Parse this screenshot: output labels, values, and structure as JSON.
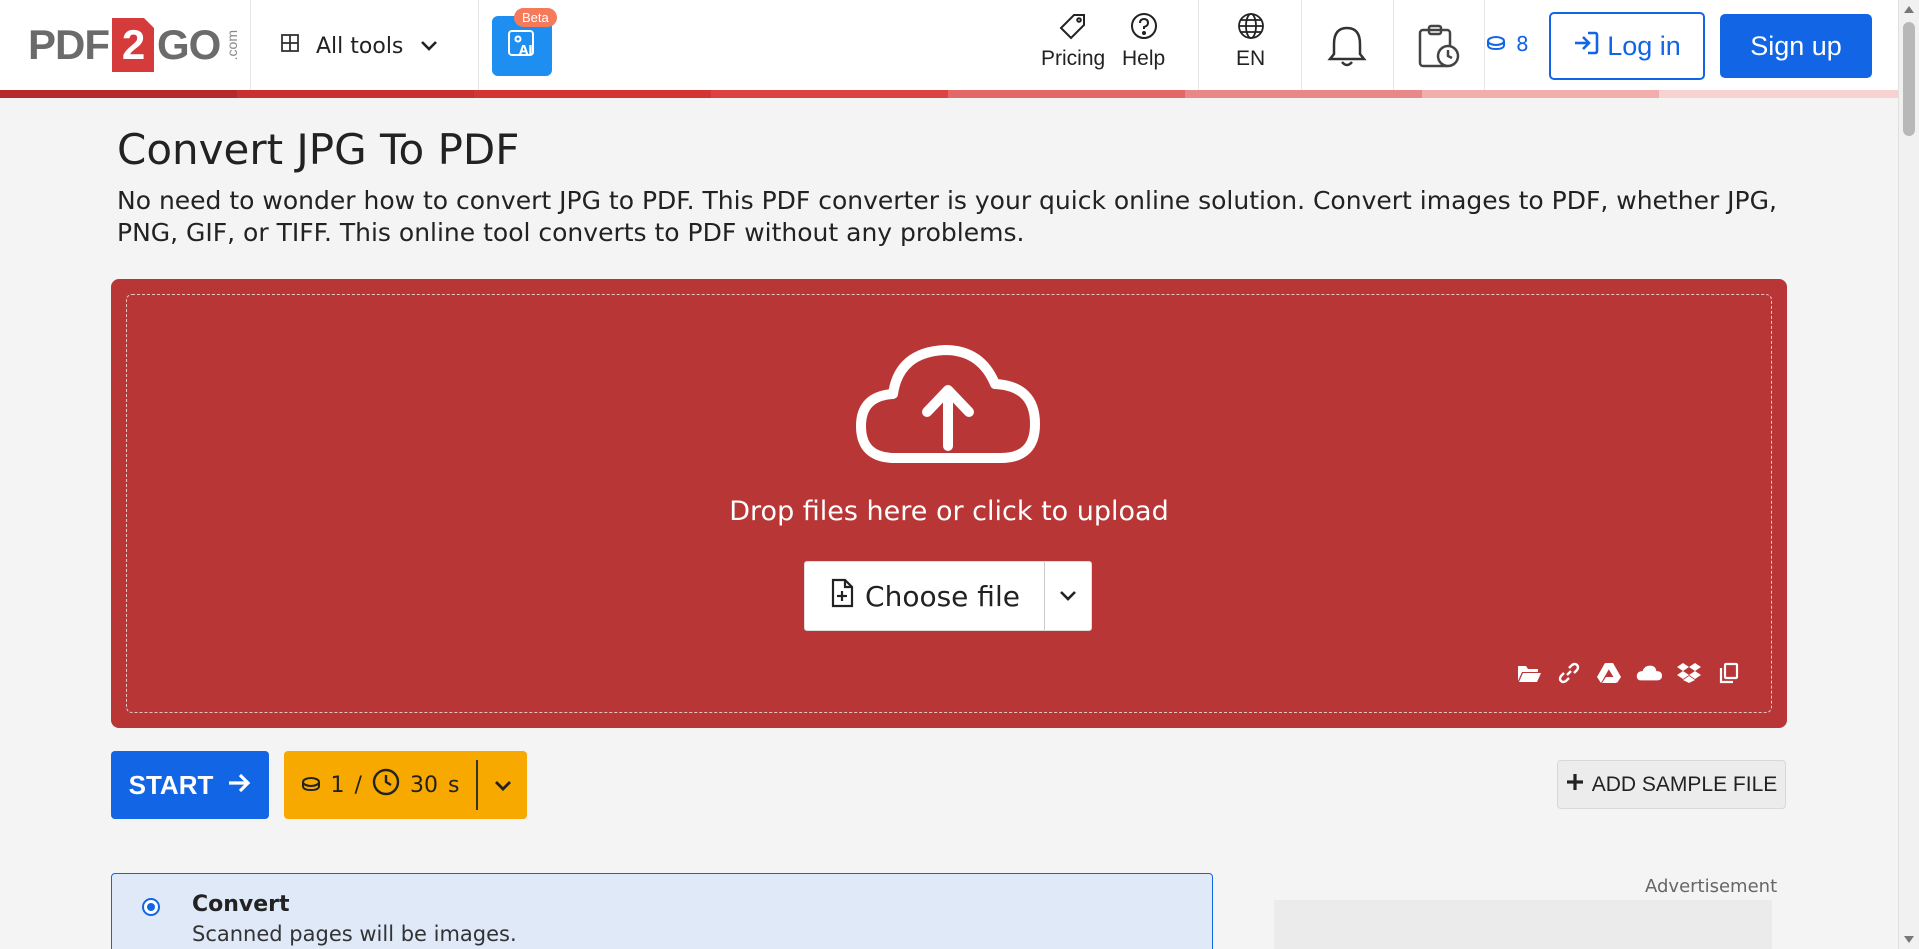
{
  "brand": {
    "logo_left": "PDF",
    "logo_num": "2",
    "logo_right": "GO",
    "logo_suffix": ".com"
  },
  "header": {
    "all_tools": "All tools",
    "ai_badge": "Beta",
    "pricing": "Pricing",
    "help": "Help",
    "language": "EN",
    "credits": "8",
    "login": "Log in",
    "signup": "Sign up"
  },
  "main": {
    "title": "Convert JPG To PDF",
    "description": "No need to wonder how to convert JPG to PDF. This PDF converter is your quick online solution. Convert images to PDF, whether JPG, PNG, GIF, or TIFF. This online tool converts to PDF without any problems.",
    "drop_text": "Drop files here or click to upload",
    "choose_file": "Choose file",
    "start": "START",
    "cost_credits": "1",
    "cost_sep": "/",
    "cost_time": "30",
    "cost_unit": "s",
    "add_sample": "ADD SAMPLE FILE",
    "option_title": "Convert",
    "option_sub": "Scanned pages will be images.",
    "ad_label": "Advertisement"
  },
  "colors": {
    "accent": "#1266e6",
    "dropzone": "#b93636",
    "cost": "#f7a900",
    "stripe": [
      "#b52a2a",
      "#c93030",
      "#d93b3b",
      "#e05555",
      "#e77878",
      "#ee9a9a",
      "#f5bcbc",
      "#fbd8d8"
    ]
  }
}
